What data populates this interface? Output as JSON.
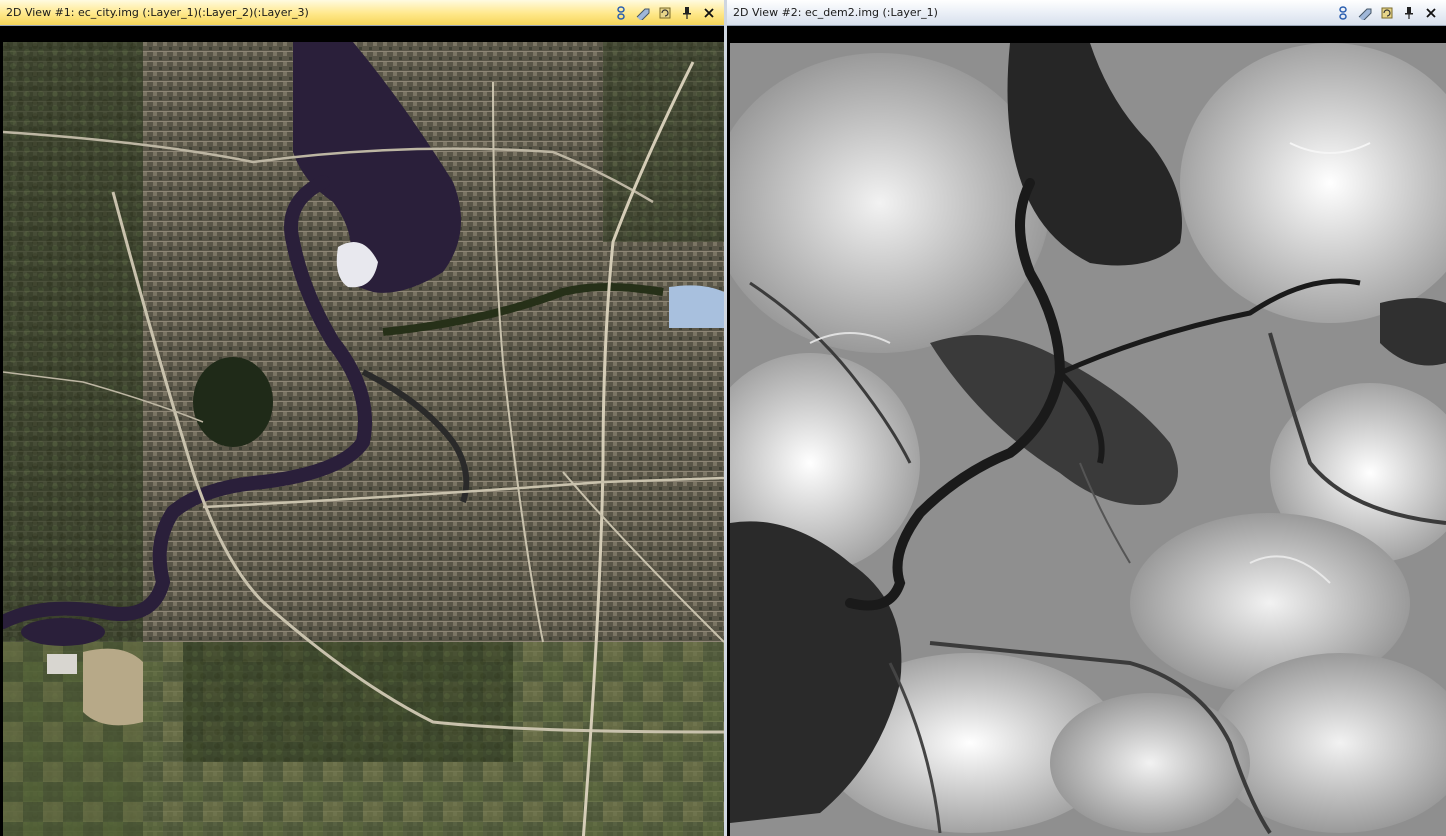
{
  "views": [
    {
      "title": "2D View #1: ec_city.img (:Layer_1)(:Layer_2)(:Layer_3)",
      "state": "active",
      "icons": [
        "link-icon",
        "pan-icon",
        "refresh-icon",
        "pin-icon",
        "close-icon"
      ]
    },
    {
      "title": "2D View #2: ec_dem2.img (:Layer_1)",
      "state": "inactive",
      "icons": [
        "link-icon",
        "pan-icon",
        "refresh-icon",
        "pin-icon",
        "close-icon"
      ]
    }
  ],
  "icon_glyphs": {
    "link-icon": "⚲",
    "pan-icon": "➶",
    "refresh-icon": "⟳",
    "pin-icon": "📌",
    "close-icon": "✕"
  },
  "colors": {
    "active_title": "#ffe88a",
    "inactive_title": "#e9eef6",
    "water_satellite": "#2a1f3a",
    "water_dem": "#1a1a1a"
  }
}
